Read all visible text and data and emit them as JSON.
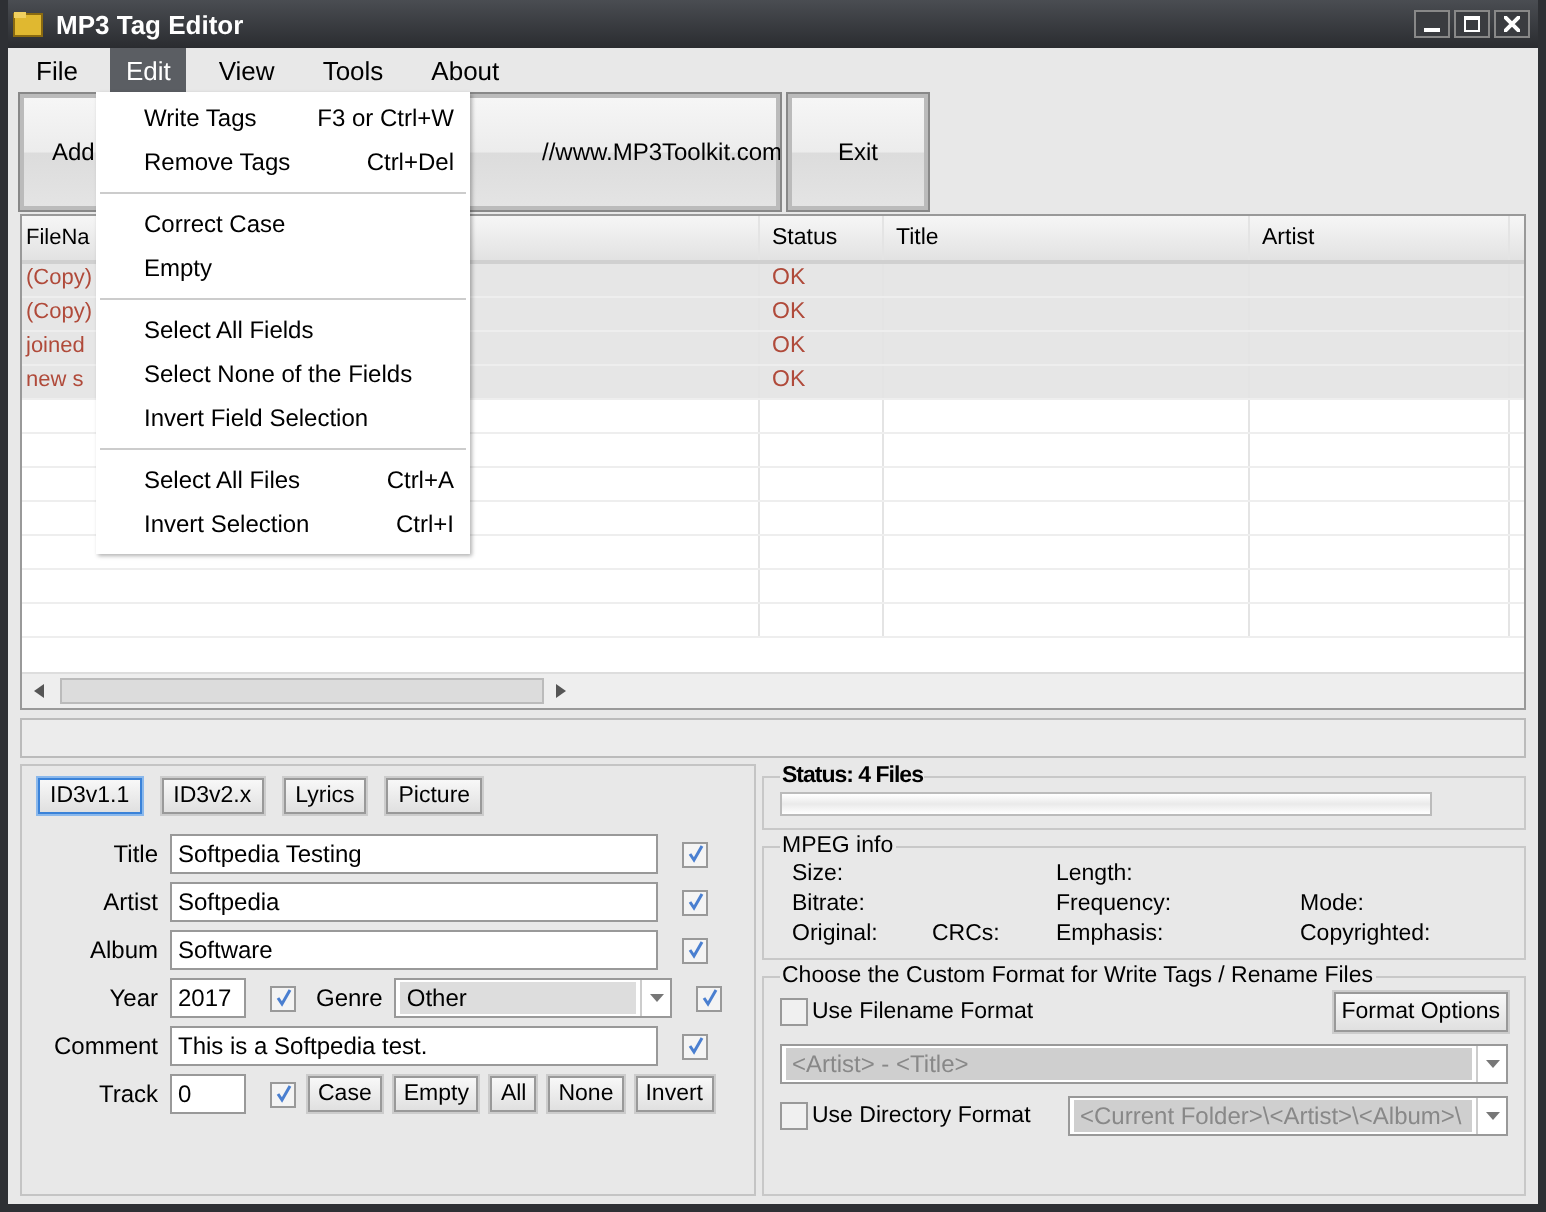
{
  "window": {
    "title": "MP3 Tag Editor"
  },
  "menu": [
    {
      "label": "File",
      "selected": false
    },
    {
      "label": "Edit",
      "selected": true
    },
    {
      "label": "View",
      "selected": false
    },
    {
      "label": "Tools",
      "selected": false
    },
    {
      "label": "About",
      "selected": false
    }
  ],
  "edit_menu": [
    [
      {
        "label": "Write Tags",
        "shortcut": "F3 or Ctrl+W"
      },
      {
        "label": "Remove Tags",
        "shortcut": "Ctrl+Del"
      }
    ],
    [
      {
        "label": "Correct Case"
      },
      {
        "label": "Empty"
      }
    ],
    [
      {
        "label": "Select All Fields"
      },
      {
        "label": "Select None of the Fields"
      },
      {
        "label": "Invert Field Selection"
      }
    ],
    [
      {
        "label": "Select All Files",
        "shortcut": "Ctrl+A"
      },
      {
        "label": "Invert Selection",
        "shortcut": "Ctrl+I"
      }
    ]
  ],
  "toolbar": [
    "Add",
    "//www.MP3Toolkit.com",
    "Exit"
  ],
  "table": {
    "columns": [
      "FileNa",
      "Status",
      "Title",
      "Artist"
    ],
    "rows": [
      {
        "file": "(Copy)",
        "status": "OK",
        "selected": true
      },
      {
        "file": "(Copy)",
        "status": "OK",
        "selected": true
      },
      {
        "file": "joined",
        "status": "OK",
        "selected": true
      },
      {
        "file": "new s",
        "status": "OK",
        "selected": true
      }
    ]
  },
  "tag_tabs": [
    {
      "label": "ID3v1.1",
      "selected": true
    },
    {
      "label": "ID3v2.x",
      "selected": false
    },
    {
      "label": "Lyrics",
      "selected": false
    },
    {
      "label": "Picture",
      "selected": false
    }
  ],
  "fields": [
    {
      "label": "Title",
      "value": "Softpedia Testing",
      "checked": true
    },
    {
      "label": "Artist",
      "value": "Softpedia",
      "checked": true
    },
    {
      "label": "Album",
      "value": "Software",
      "checked": true
    },
    {
      "label": "Comment",
      "value": "This is a Softpedia test.",
      "checked": true
    }
  ],
  "year": {
    "label": "Year",
    "value": "2017",
    "checked": true
  },
  "genre": {
    "label": "Genre",
    "value": "Other",
    "checked": true
  },
  "track": {
    "label": "Track",
    "value": "0",
    "checked": true
  },
  "field_buttons": [
    "Case",
    "Empty",
    "All",
    "None",
    "Invert"
  ],
  "status": {
    "title": "Status: 4 Files",
    "level": 0
  },
  "mpeg_info": {
    "title": "MPEG info",
    "rows": [
      [
        "Size:",
        "",
        "Length:",
        ""
      ],
      [
        "Bitrate:",
        "",
        "Frequency:",
        "Mode:"
      ],
      [
        "Original:",
        "CRCs:",
        "Emphasis:",
        "Copyrighted:"
      ]
    ]
  },
  "custom_format": {
    "title": "Choose the Custom Format for Write Tags / Rename Files",
    "filename_option": {
      "label": "Use Filename Format",
      "checked": false
    },
    "format_button": "Format Options",
    "filename_format": "<Artist> - <Title>",
    "directory_option": {
      "label": "Use Directory Format",
      "checked": false
    },
    "directory_format": "<Current Folder>\\<Artist>\\<Album>\\"
  }
}
